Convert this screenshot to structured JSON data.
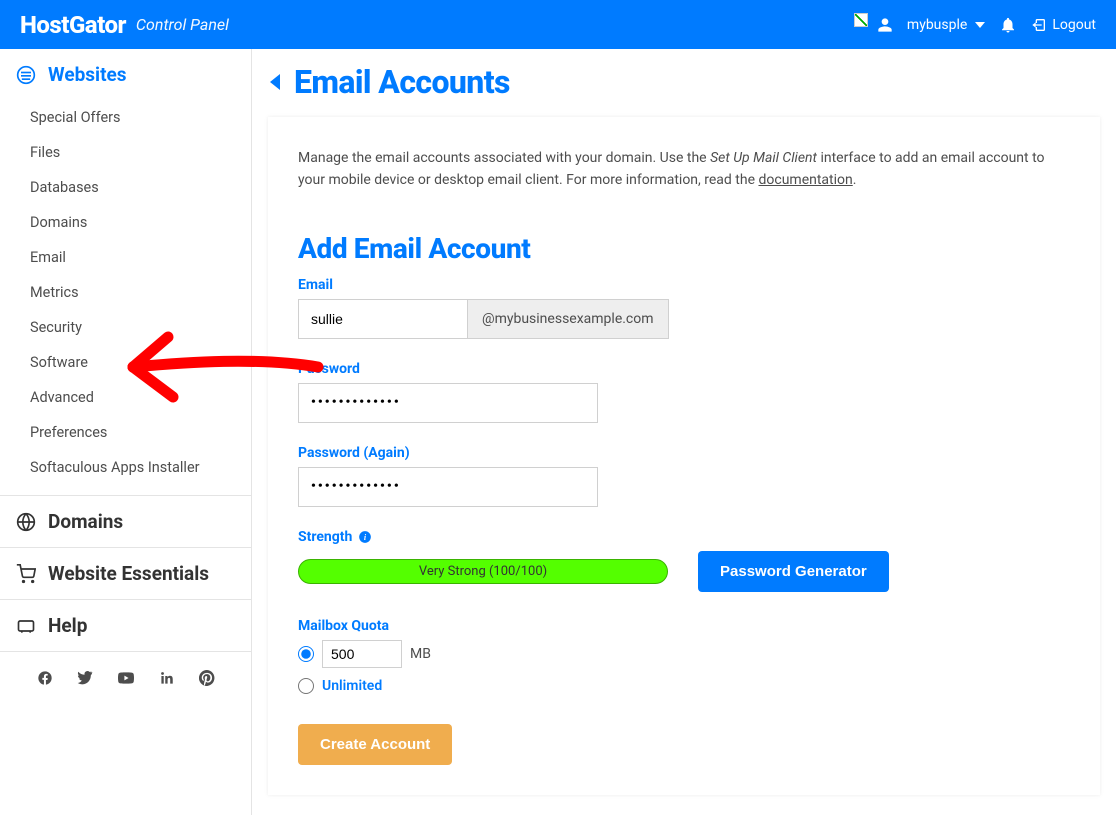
{
  "header": {
    "brand": "HostGator",
    "subtitle": "Control Panel",
    "username": "mybusple",
    "logout": "Logout"
  },
  "sidebar": {
    "sections": [
      {
        "title": "Websites",
        "active": true,
        "items": [
          "Special Offers",
          "Files",
          "Databases",
          "Domains",
          "Email",
          "Metrics",
          "Security",
          "Software",
          "Advanced",
          "Preferences",
          "Softaculous Apps Installer"
        ]
      },
      {
        "title": "Domains",
        "active": false,
        "items": []
      },
      {
        "title": "Website Essentials",
        "active": false,
        "items": []
      },
      {
        "title": "Help",
        "active": false,
        "items": []
      }
    ]
  },
  "page": {
    "title": "Email Accounts",
    "intro_pre": "Manage the email accounts associated with your domain. Use the ",
    "intro_em": "Set Up Mail Client",
    "intro_mid": " interface to add an email account to your mobile device or desktop email client. For more information, read the ",
    "intro_link": "documentation",
    "intro_post": ".",
    "add_heading": "Add Email Account",
    "labels": {
      "email": "Email",
      "password": "Password",
      "password2": "Password (Again)",
      "strength": "Strength",
      "quota": "Mailbox Quota",
      "mb": "MB",
      "unlimited": "Unlimited"
    },
    "values": {
      "email_name": "sullie",
      "domain": "@mybusinessexample.com",
      "password": "•••••••••••••",
      "password2": "•••••••••••••",
      "strength_text": "Very Strong (100/100)",
      "quota_value": "500"
    },
    "buttons": {
      "pwgen": "Password Generator",
      "create": "Create Account"
    }
  }
}
